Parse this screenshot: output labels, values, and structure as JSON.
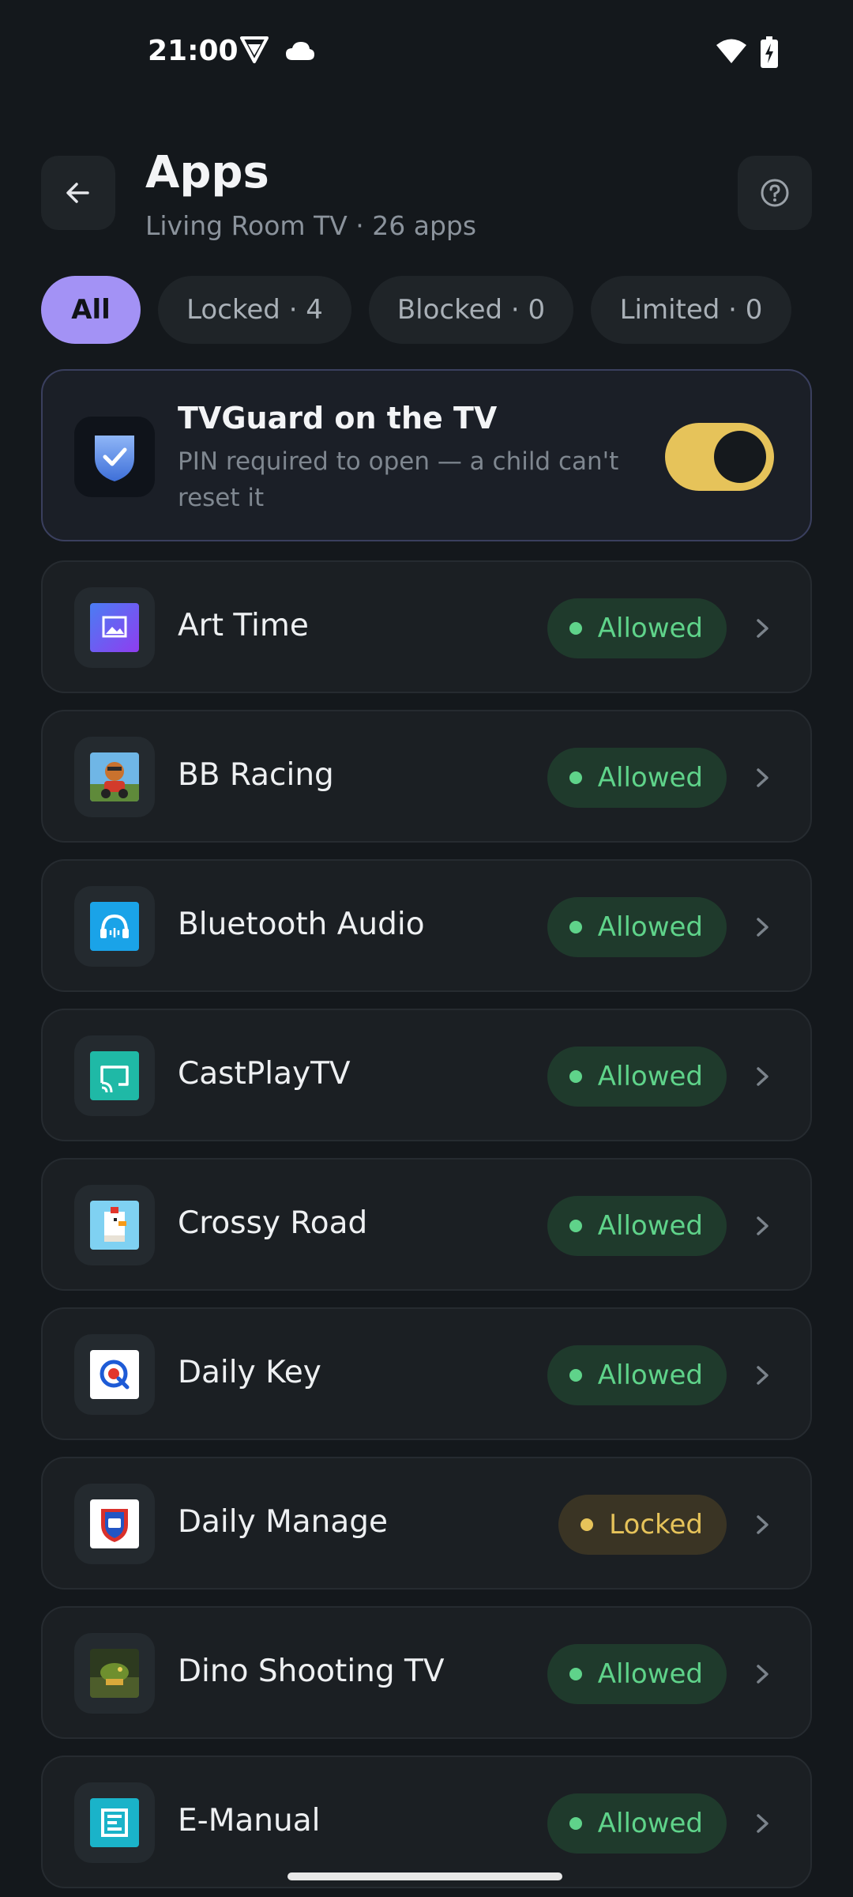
{
  "status": {
    "time": "21:00"
  },
  "header": {
    "title": "Apps",
    "subtitle": "Living Room TV · 26 apps"
  },
  "filters": [
    {
      "label": "All",
      "active": true
    },
    {
      "label": "Locked · 4",
      "active": false
    },
    {
      "label": "Blocked · 0",
      "active": false
    },
    {
      "label": "Limited · 0",
      "active": false
    }
  ],
  "guard": {
    "title": "TVGuard on the TV",
    "description": "PIN required to open — a child can't reset it",
    "enabled": true
  },
  "apps": [
    {
      "name": "Art Time",
      "status": "Allowed",
      "icon": "art-time-icon"
    },
    {
      "name": "BB Racing",
      "status": "Allowed",
      "icon": "bb-racing-icon"
    },
    {
      "name": "Bluetooth Audio",
      "status": "Allowed",
      "icon": "bluetooth-audio-icon"
    },
    {
      "name": "CastPlayTV",
      "status": "Allowed",
      "icon": "castplaytv-icon"
    },
    {
      "name": "Crossy Road",
      "status": "Allowed",
      "icon": "crossy-road-icon"
    },
    {
      "name": "Daily Key",
      "status": "Allowed",
      "icon": "daily-key-icon"
    },
    {
      "name": "Daily Manage",
      "status": "Locked",
      "icon": "daily-manage-icon"
    },
    {
      "name": "Dino Shooting TV",
      "status": "Allowed",
      "icon": "dino-shooting-icon"
    },
    {
      "name": "E-Manual",
      "status": "Allowed",
      "icon": "e-manual-icon"
    }
  ],
  "colors": {
    "accent": "#a392f5",
    "allowed": "#5fd38a",
    "locked": "#e6c35a",
    "background": "#14181c"
  }
}
